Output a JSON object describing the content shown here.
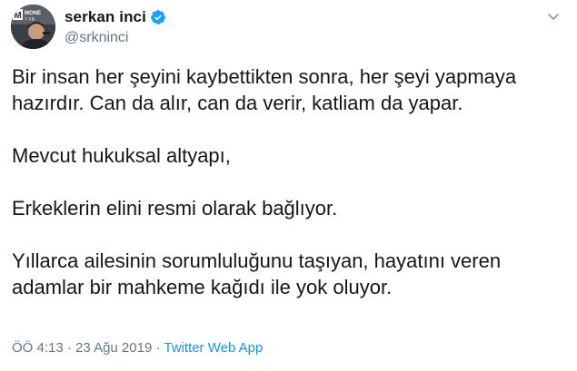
{
  "user": {
    "display_name": "serkan inci",
    "handle": "@srkninci",
    "verified": true,
    "verified_color": "#1da1f2",
    "avatar_text_top": "MONE",
    "avatar_text_bottom": "Y FR",
    "avatar_letter": "M"
  },
  "tweet": {
    "line_1": "Bir insan her şeyini kaybettikten sonra, her şeyi yapmaya",
    "line_2": "hazırdır. Can da alır, can da verir, katliam da yapar.",
    "line_3": "Mevcut hukuksal altyapı,",
    "line_4": "Erkeklerin elini resmi olarak bağlıyor.",
    "line_5": "Yıllarca ailesinin sorumluluğunu taşıyan, hayatını veren",
    "line_6": "adamlar bir mahkeme kağıdı ile yok oluyor."
  },
  "meta": {
    "time": "ÖÖ 4:13",
    "separator_1": " · ",
    "date": "23 Ağu 2019",
    "separator_2": " · ",
    "source": "Twitter Web App"
  },
  "icons": {
    "verified": "verified-badge-icon",
    "menu": "chevron-down-icon"
  },
  "colors": {
    "text": "#14171a",
    "secondary": "#657786",
    "link": "#1b95e0",
    "verified": "#1da1f2"
  }
}
